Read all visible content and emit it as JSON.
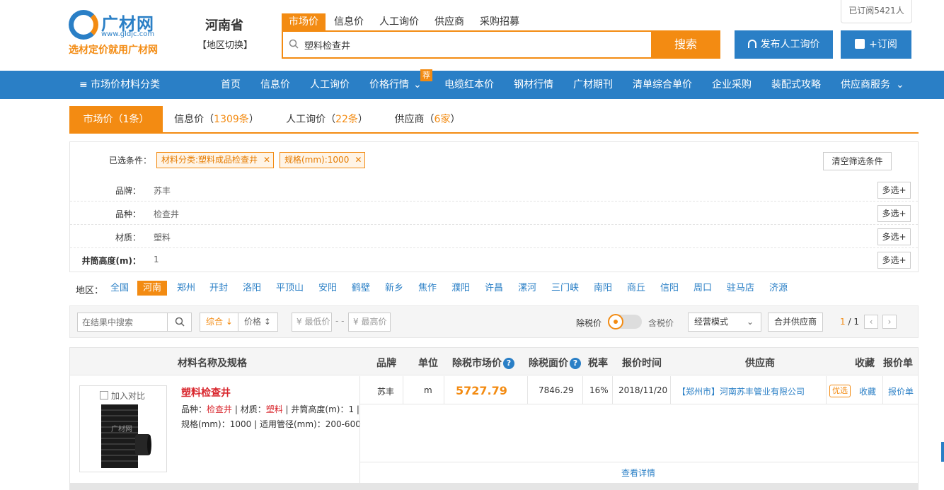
{
  "logo": {
    "name": "广材网",
    "url": "www.gldjc.com",
    "slogan": "选材定价就用广材网"
  },
  "region": {
    "province": "河南省",
    "switch_label": "【地区切换】"
  },
  "search": {
    "tabs": [
      "市场价",
      "信息价",
      "人工询价",
      "供应商",
      "采购招募"
    ],
    "query": "塑料检查井",
    "button": "搜索"
  },
  "header_buttons": {
    "inquiry": "发布人工询价",
    "subscribe": "+订阅",
    "subscribed": "已订阅5421人"
  },
  "nav": {
    "category": "≡ 市场价材料分类",
    "items": [
      "首页",
      "信息价",
      "人工询价",
      "价格行情",
      "电缆红本价",
      "钢材行情",
      "广材期刊",
      "清单综合单价",
      "企业采购",
      "装配式攻略",
      "供应商服务"
    ],
    "badge": "荐"
  },
  "result_tabs": [
    {
      "label": "市场价（",
      "count": "1条",
      "suffix": "）"
    },
    {
      "label": "信息价（",
      "count": "1309条",
      "suffix": "）"
    },
    {
      "label": "人工询价（",
      "count": "22条",
      "suffix": "）"
    },
    {
      "label": "供应商（",
      "count": "6家",
      "suffix": "）"
    }
  ],
  "filters": {
    "selected_label": "已选条件：",
    "chips": [
      "材料分类:塑料成品检查井",
      "规格(mm):1000"
    ],
    "clear": "清空筛选条件",
    "multi": "多选+",
    "rows": [
      {
        "label": "品牌：",
        "value": "苏丰"
      },
      {
        "label": "品种：",
        "value": "检查井"
      },
      {
        "label": "材质：",
        "value": "塑料"
      },
      {
        "label": "井筒高度(m)：",
        "value": "1"
      }
    ]
  },
  "regions": {
    "label": "地区：",
    "items": [
      "全国",
      "河南",
      "郑州",
      "开封",
      "洛阳",
      "平顶山",
      "安阳",
      "鹤壁",
      "新乡",
      "焦作",
      "濮阳",
      "许昌",
      "漯河",
      "三门峡",
      "南阳",
      "商丘",
      "信阳",
      "周口",
      "驻马店",
      "济源"
    ]
  },
  "toolbar": {
    "search_placeholder": "在结果中搜索",
    "sort_comprehensive": "综合 ↓",
    "sort_price": "价格 ↕",
    "min_price": "¥ 最低价",
    "dash": "- -",
    "max_price": "¥ 最高价",
    "tax_excl": "除税价",
    "tax_incl": "含税价",
    "mode": "经营模式",
    "merge": "合并供应商",
    "page_current": "1",
    "page_total": " / 1"
  },
  "table": {
    "headers": [
      "材料名称及规格",
      "品牌",
      "单位",
      "除税市场价",
      "除税面价",
      "税率",
      "报价时间",
      "供应商",
      "收藏",
      "报价单"
    ],
    "row": {
      "compare": "加入对比",
      "img_watermark": "广材网",
      "name": "塑料检查井",
      "attr1_parts": [
        "品种：",
        "检查井",
        " | 材质：",
        "塑料",
        " | ",
        "井筒高度(m)：1",
        " |"
      ],
      "attr2": "规格(mm)：1000 | 适用管径(mm)：200-600",
      "brand": "苏丰",
      "unit": "m",
      "price": "5727.79",
      "face_price": "7846.29",
      "tax_rate": "16%",
      "date": "2018/11/20",
      "supplier": "【郑州市】河南苏丰管业有限公司",
      "badge": "优选",
      "collect": "收藏",
      "quote": "报价单",
      "detail": "查看详情"
    }
  },
  "colors": {
    "brand_blue": "#2a7fc6",
    "brand_orange": "#f38b12",
    "red": "#d9272e"
  }
}
